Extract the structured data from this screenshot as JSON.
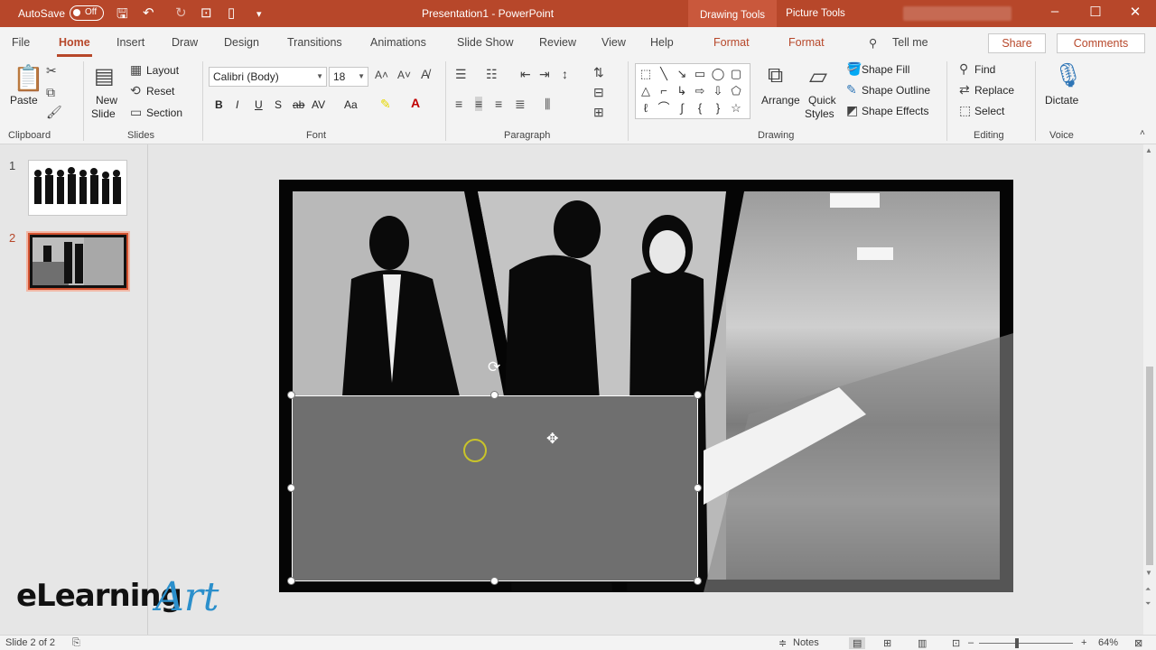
{
  "titlebar": {
    "autosave_label": "AutoSave",
    "autosave_state": "Off",
    "document_title": "Presentation1  -  PowerPoint",
    "context_drawing": "Drawing Tools",
    "context_picture": "Picture Tools",
    "minimize": "–",
    "maximize": "☐",
    "close": "✕"
  },
  "tabs": {
    "file": "File",
    "home": "Home",
    "insert": "Insert",
    "draw": "Draw",
    "design": "Design",
    "transitions": "Transitions",
    "animations": "Animations",
    "slideshow": "Slide Show",
    "review": "Review",
    "view": "View",
    "help": "Help",
    "format1": "Format",
    "format2": "Format",
    "tellme": "Tell me",
    "share": "Share",
    "comments": "Comments"
  },
  "ribbon": {
    "clipboard": {
      "label": "Clipboard",
      "paste": "Paste"
    },
    "slides": {
      "label": "Slides",
      "new_slide": "New",
      "new_slide2": "Slide",
      "layout": "Layout",
      "reset": "Reset",
      "section": "Section"
    },
    "font": {
      "label": "Font",
      "font_name": "Calibri (Body)",
      "font_size": "18",
      "bold": "B",
      "italic": "I",
      "underline": "U",
      "strike": "S",
      "shadow": "ab",
      "spacing": "AV",
      "case": "Aa"
    },
    "paragraph": {
      "label": "Paragraph"
    },
    "drawing": {
      "label": "Drawing",
      "arrange": "Arrange",
      "quick_styles": "Quick",
      "quick_styles2": "Styles",
      "shape_fill": "Shape Fill",
      "shape_outline": "Shape Outline",
      "shape_effects": "Shape Effects"
    },
    "editing": {
      "label": "Editing",
      "find": "Find",
      "replace": "Replace",
      "select": "Select"
    },
    "voice": {
      "label": "Voice",
      "dictate": "Dictate"
    }
  },
  "thumbnails": [
    {
      "number": "1"
    },
    {
      "number": "2"
    }
  ],
  "logo": {
    "text": "eLearning",
    "art": "Art"
  },
  "status": {
    "slide_info": "Slide 2 of 2",
    "notes": "Notes",
    "zoom": "64%"
  },
  "colors": {
    "accent": "#b7472a",
    "selection": "#ffffff",
    "cursor_ring": "#c9c42a",
    "logo_blue": "#2b8fcb"
  }
}
